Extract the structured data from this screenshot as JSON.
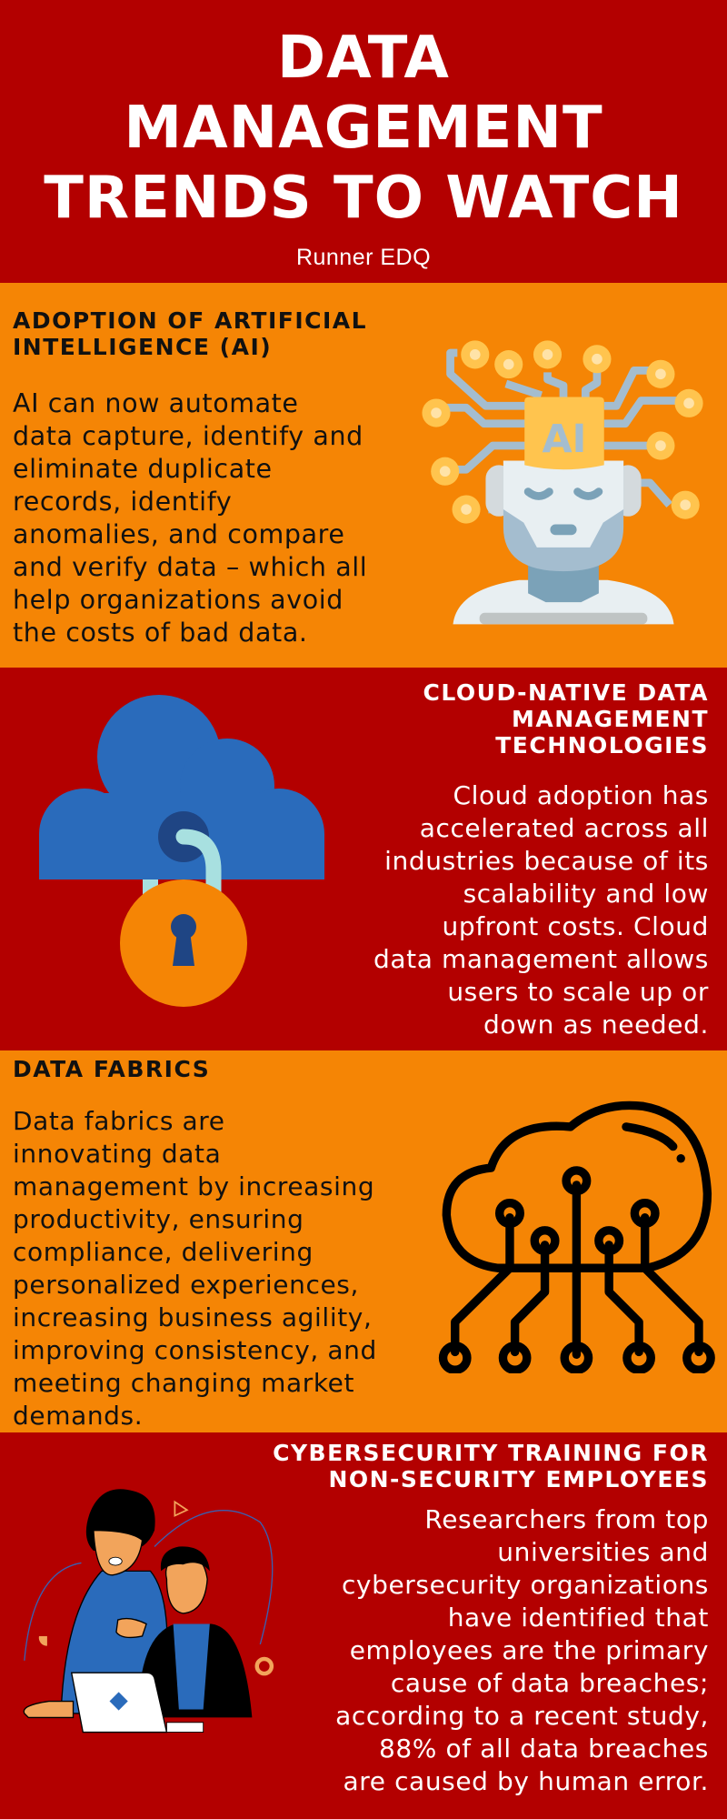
{
  "header": {
    "title_lines": [
      "DATA",
      "MANAGEMENT",
      "TRENDS TO WATCH"
    ],
    "subtitle": "Runner EDQ"
  },
  "colors": {
    "red": "#B30000",
    "orange": "#F58505",
    "cloud_blue": "#2A6BBB",
    "dark_blue": "#1F4584",
    "shackle": "#A8E0E0",
    "chip_yellow": "#FFC44E",
    "robot_gray": "#A4BDCF"
  },
  "sections": [
    {
      "heading": "ADOPTION OF ARTIFICIAL\nINTELLIGENCE (AI)",
      "body": "AI can now automate\ndata capture, identify and\neliminate duplicate\nrecords, identify\nanomalies, and compare\nand verify data – which all\nhelp organizations avoid\nthe costs of bad data.",
      "icon": "ai-robot-head-icon",
      "icon_label": "AI"
    },
    {
      "heading": "CLOUD-NATIVE DATA\nMANAGEMENT\nTECHNOLOGIES",
      "body": "Cloud adoption has\naccelerated across all\nindustries because of its\nscalability and low\nupfront costs. Cloud\ndata management allows\nusers to scale up or\ndown as needed.",
      "icon": "cloud-lock-icon"
    },
    {
      "heading": "DATA FABRICS",
      "body": "Data fabrics are\ninnovating data\nmanagement by increasing\nproductivity, ensuring\ncompliance, delivering\npersonalized experiences,\nincreasing business agility,\nimproving consistency, and\nmeeting changing market\ndemands.",
      "icon": "cloud-circuit-icon"
    },
    {
      "heading": "CYBERSECURITY TRAINING FOR\nNON-SECURITY EMPLOYEES",
      "body": "Researchers from top\nuniversities and\ncybersecurity organizations\nhave identified that\nemployees are the primary\ncause of data breaches;\naccording to a recent study,\n88% of all data breaches\nare caused by human error.",
      "icon": "coworkers-laptop-illustration"
    }
  ]
}
